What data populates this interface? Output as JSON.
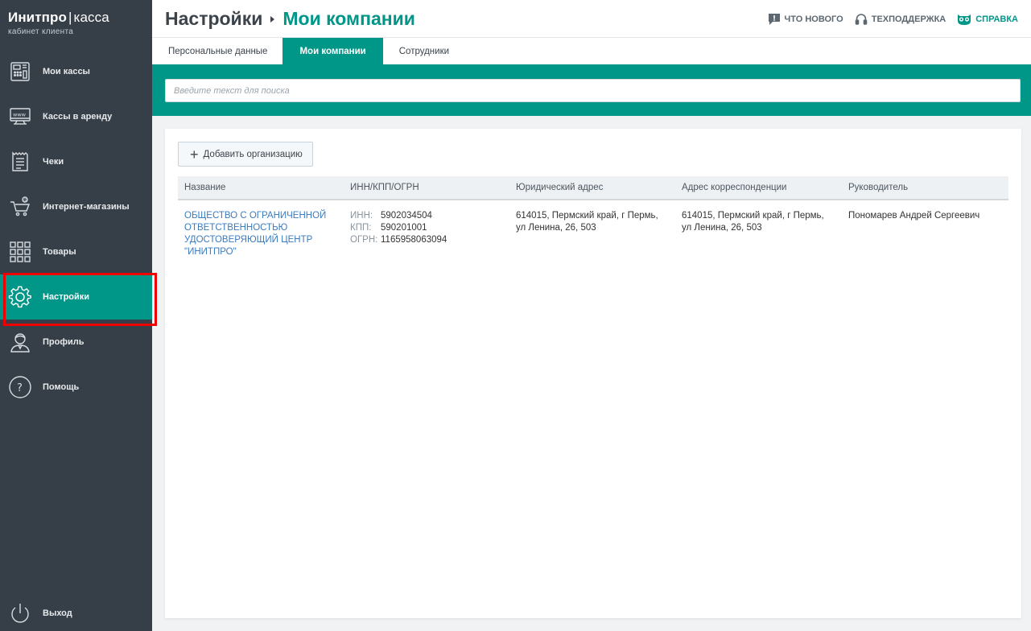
{
  "app": {
    "name_bold": "Инитпро",
    "name_sep": "|",
    "name_thin": "касса",
    "subtitle": "кабинет клиента"
  },
  "sidebar": {
    "items": [
      {
        "label": "Мои кассы",
        "icon": "cash-register-icon"
      },
      {
        "label": "Кассы в аренду",
        "icon": "www-terminal-icon"
      },
      {
        "label": "Чеки",
        "icon": "receipt-icon"
      },
      {
        "label": "Интернет-магазины",
        "icon": "cart-icon"
      },
      {
        "label": "Товары",
        "icon": "grid-icon"
      },
      {
        "label": "Настройки",
        "icon": "gear-icon",
        "active": true
      },
      {
        "label": "Профиль",
        "icon": "user-icon"
      },
      {
        "label": "Помощь",
        "icon": "help-icon"
      }
    ],
    "logout": "Выход"
  },
  "header": {
    "breadcrumb_root": "Настройки",
    "breadcrumb_current": "Мои компании",
    "links": {
      "whats_new": "Что нового",
      "support": "Техподдержка",
      "help": "Справка"
    }
  },
  "tabs": [
    {
      "label": "Персональные данные"
    },
    {
      "label": "Мои компании",
      "active": true
    },
    {
      "label": "Сотрудники"
    }
  ],
  "search": {
    "placeholder": "Введите текст для поиска",
    "value": ""
  },
  "companies": {
    "add_button": "Добавить организацию",
    "columns": [
      "Название",
      "ИНН/КПП/ОГРН",
      "Юридический адрес",
      "Адрес корреспонденции",
      "Руководитель"
    ],
    "rows": [
      {
        "name": "ОБЩЕСТВО С ОГРАНИЧЕННОЙ ОТВЕТСТВЕННОСТЬЮ УДОСТОВЕРЯЮЩИЙ ЦЕНТР \"ИНИТПРО\"",
        "inn_label": "ИНН:",
        "inn": "5902034504",
        "kpp_label": "КПП:",
        "kpp": "590201001",
        "ogrn_label": "ОГРН:",
        "ogrn": "1165958063094",
        "legal_address": "614015, Пермский край, г Пермь, ул Ленина, 26, 503",
        "postal_address": "614015, Пермский край, г Пермь, ул Ленина, 26, 503",
        "director": "Пономарев Андрей Сергеевич"
      }
    ]
  },
  "colors": {
    "sidebar_bg": "#363e47",
    "accent": "#009688",
    "link": "#3b7bbf",
    "highlight_border": "#ee0000"
  }
}
